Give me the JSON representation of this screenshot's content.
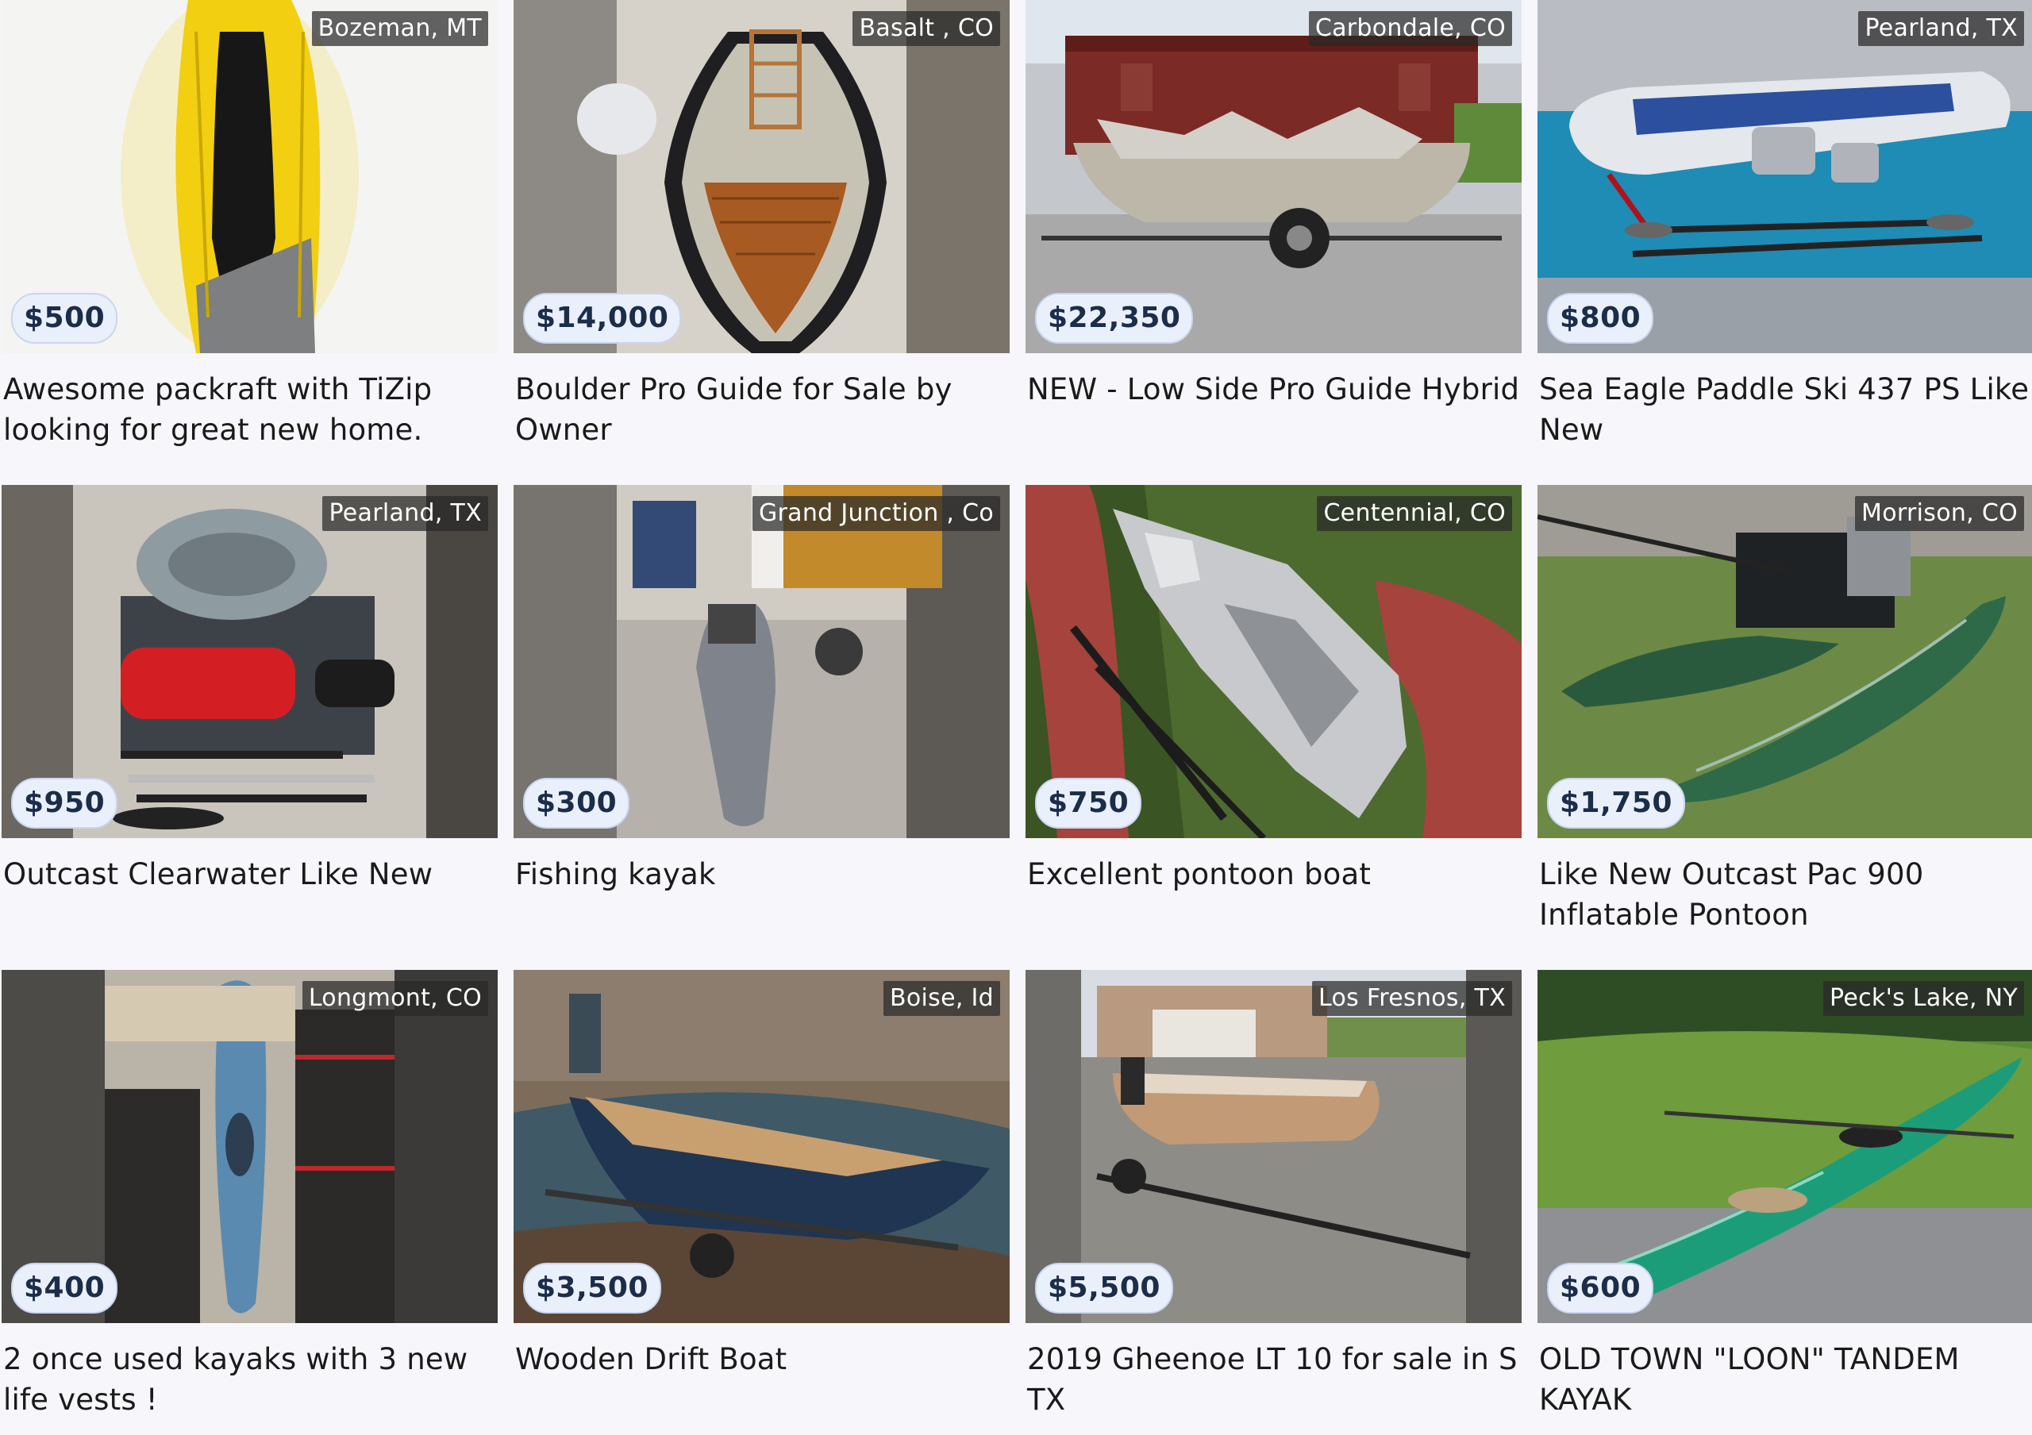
{
  "listings": [
    {
      "location": "Bozeman, MT",
      "price": "$500",
      "title": "Awesome packraft with TiZip looking for great new home.",
      "image": "yellow-packraft-photo"
    },
    {
      "location": "Basalt , CO",
      "price": "$14,000",
      "title": "Boulder Pro Guide for Sale by Owner",
      "image": "wooden-drift-boat-photo"
    },
    {
      "location": "Carbondale, CO",
      "price": "$22,350",
      "title": "NEW - Low Side Pro Guide Hybrid",
      "image": "drift-boat-on-trailer-photo"
    },
    {
      "location": "Pearland, TX",
      "price": "$800",
      "title": "Sea Eagle Paddle Ski 437 PS Like New",
      "image": "inflatable-kayak-photo"
    },
    {
      "location": "Pearland, TX",
      "price": "$950",
      "title": "Outcast Clearwater Like New",
      "image": "raft-with-oars-photo"
    },
    {
      "location": "Grand Junction , Co",
      "price": "$300",
      "title": "Fishing kayak",
      "image": "gray-fishing-kayak-photo"
    },
    {
      "location": "Centennial, CO",
      "price": "$750",
      "title": "Excellent pontoon boat",
      "image": "pontoon-frame-photo"
    },
    {
      "location": "Morrison, CO",
      "price": "$1,750",
      "title": "Like New Outcast Pac 900 Inflatable Pontoon",
      "image": "green-pontoon-photo"
    },
    {
      "location": "Longmont, CO",
      "price": "$400",
      "title": "2 once used kayaks with 3 new life vests !",
      "image": "blue-kayak-garage-photo"
    },
    {
      "location": "Boise, Id",
      "price": "$3,500",
      "title": "Wooden Drift Boat",
      "image": "wooden-drift-boat-water-photo"
    },
    {
      "location": "Los Fresnos, TX",
      "price": "$5,500",
      "title": "2019 Gheenoe LT 10 for sale in S TX",
      "image": "gheenoe-on-trailer-photo"
    },
    {
      "location": "Peck's Lake, NY",
      "price": "$600",
      "title": "OLD TOWN \"LOON\" TANDEM KAYAK",
      "image": "green-tandem-kayak-photo"
    }
  ]
}
